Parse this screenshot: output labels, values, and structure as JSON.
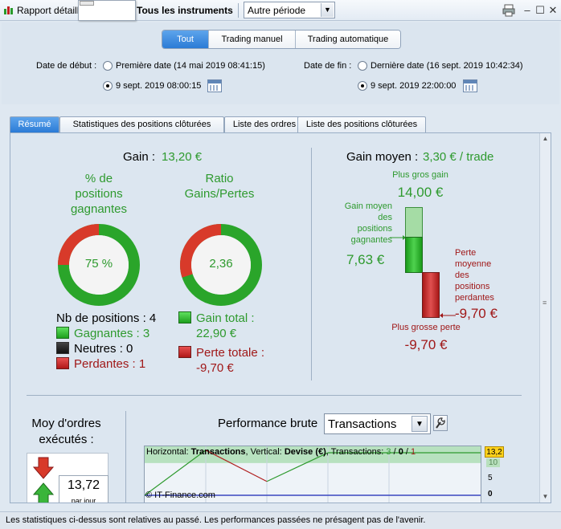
{
  "window": {
    "title": "Rapport détaillé",
    "instruments": "Tous les instruments",
    "period": "Autre période"
  },
  "mode_tabs": [
    "Tout",
    "Trading manuel",
    "Trading automatique"
  ],
  "dates": {
    "start_label": "Date de début :",
    "start_option1": "Première date (14 mai 2019 08:41:15)",
    "start_option2": "9 sept. 2019 08:00:15",
    "end_label": "Date de fin :",
    "end_option1": "Dernière date (16 sept. 2019 10:42:34)",
    "end_option2": "9 sept. 2019 22:00:00"
  },
  "report_tabs": [
    "Résumé",
    "Statistiques des positions clôturées",
    "Liste des ordres",
    "Liste des positions clôturées"
  ],
  "summary": {
    "gain_label": "Gain :",
    "gain_value": "13,20 €",
    "pct_title_1": "% de",
    "pct_title_2": "positions",
    "pct_title_3": "gagnantes",
    "pct_value": "75 %",
    "pct_fraction": 0.75,
    "ratio_title_1": "Ratio",
    "ratio_title_2": "Gains/Pertes",
    "ratio_value": "2,36",
    "ratio_fraction": 0.7,
    "nb_positions": "Nb de positions : 4",
    "gagnantes": "Gagnantes : 3",
    "neutres": "Neutres : 0",
    "perdantes": "Perdantes : 1",
    "gain_total_label": "Gain total :",
    "gain_total_value": "22,90 €",
    "perte_totale_label": "Perte totale :",
    "perte_totale_value": "-9,70 €"
  },
  "avg_gain": {
    "label": "Gain moyen :",
    "value": "3,30 € / trade",
    "best_label": "Plus gros gain",
    "best_value": "14,00 €",
    "avg_win_1": "Gain moyen",
    "avg_win_2": "des",
    "avg_win_3": "positions",
    "avg_win_4": "gagnantes",
    "avg_win_value": "7,63 €",
    "avg_loss_1": "Perte",
    "avg_loss_2": "moyenne",
    "avg_loss_3": "des",
    "avg_loss_4": "positions",
    "avg_loss_5": "perdantes",
    "avg_loss_value": "-9,70 €",
    "worst_label": "Plus grosse perte",
    "worst_value": "-9,70 €"
  },
  "orders": {
    "title_1": "Moy d'ordres",
    "title_2": "exécutés :",
    "value": "13,72",
    "unit": "par jour"
  },
  "performance": {
    "title": "Performance brute",
    "select": "Transactions",
    "caption_h": "Horizontal:",
    "caption_h_val": "Transactions",
    "caption_v": ", Vertical:",
    "caption_v_val": "Devise (€)",
    "caption_t": ", Transactions:",
    "caption_counts_g": "3",
    "caption_counts_sep1": " / ",
    "caption_counts_n": "0",
    "caption_counts_sep2": " / ",
    "caption_counts_r": "1",
    "copyright": "© IT-Finance.com",
    "axis_top": "13,2",
    "axis_10": "10",
    "axis_5": "5",
    "axis_0": "0"
  },
  "chart_data": {
    "type": "line",
    "x": [
      0,
      1,
      2,
      3,
      4
    ],
    "y": [
      0,
      14.0,
      4.3,
      13.2,
      13.2
    ],
    "xlabel": "Transactions",
    "ylabel": "Devise (€)",
    "ylim": [
      0,
      13.2
    ]
  },
  "footer": "Les statistiques ci-dessus sont relatives au passé. Les performances passées ne présagent pas de l'avenir.",
  "colors": {
    "gain_green": "#2e9a2e",
    "loss_red": "#a01818",
    "accent_blue": "#2b7bd6"
  }
}
